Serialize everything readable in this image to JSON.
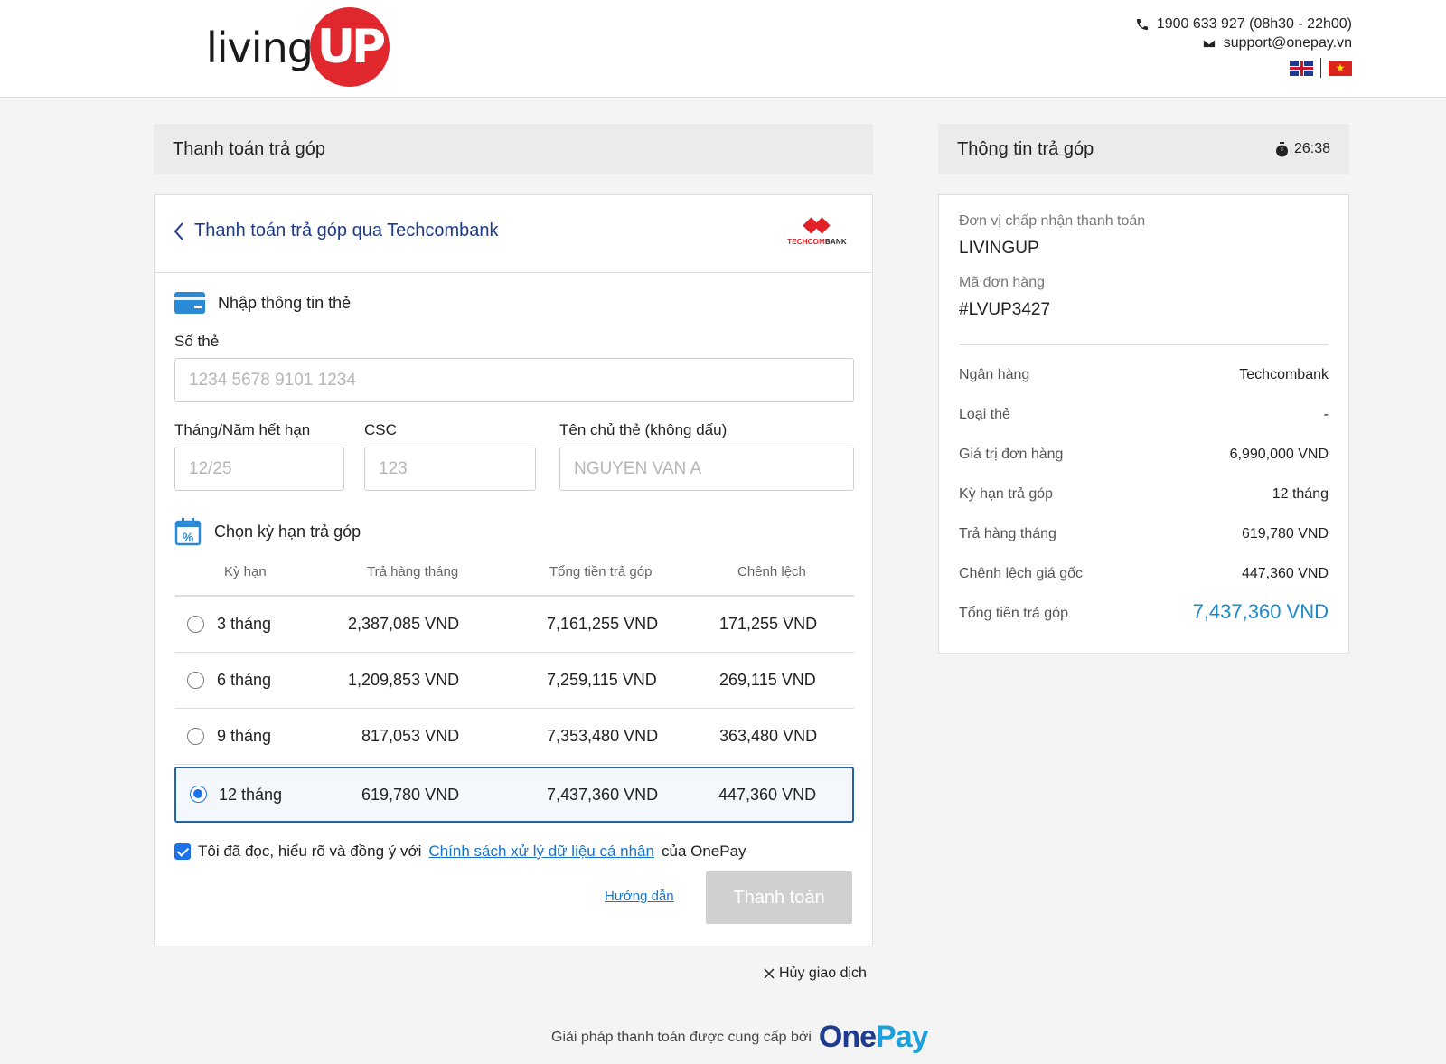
{
  "header": {
    "logo_text": "living",
    "logo_mark": "UP",
    "phone": "1900 633 927 (08h30 - 22h00)",
    "email": "support@onepay.vn",
    "flag_vn_star": "★"
  },
  "left": {
    "title": "Thanh toán trả góp",
    "back_label": "Thanh toán trả góp qua Techcombank",
    "bank_logo_a": "TECHCOM",
    "bank_logo_b": "BANK",
    "card_section": "Nhập thông tin thẻ",
    "card_number_label": "Số thẻ",
    "card_number_placeholder": "1234 5678 9101 1234",
    "expiry_label": "Tháng/Năm hết hạn",
    "expiry_placeholder": "12/25",
    "csc_label": "CSC",
    "csc_placeholder": "123",
    "holder_label": "Tên chủ thẻ (không dấu)",
    "holder_placeholder": "NGUYEN VAN A",
    "term_section": "Chọn kỳ hạn trả góp",
    "table_headers": [
      "Kỳ hạn",
      "Trả hàng tháng",
      "Tổng tiền trả góp",
      "Chênh lệch"
    ],
    "terms": [
      {
        "term": "3 tháng",
        "monthly": "2,387,085 VND",
        "total": "7,161,255 VND",
        "diff": "171,255 VND",
        "selected": false
      },
      {
        "term": "6 tháng",
        "monthly": "1,209,853 VND",
        "total": "7,259,115 VND",
        "diff": "269,115 VND",
        "selected": false
      },
      {
        "term": "9 tháng",
        "monthly": "817,053 VND",
        "total": "7,353,480 VND",
        "diff": "363,480 VND",
        "selected": false
      },
      {
        "term": "12 tháng",
        "monthly": "619,780 VND",
        "total": "7,437,360 VND",
        "diff": "447,360 VND",
        "selected": true
      }
    ],
    "agree_prefix": "Tôi đã đọc, hiểu rõ và đồng ý với",
    "agree_link": "Chính sách xử lý dữ liệu cá nhân",
    "agree_suffix": "của OnePay",
    "agree_checked": true,
    "guide_label": "Hướng dẫn",
    "pay_label": "Thanh toán",
    "cancel_label": "Hủy giao dịch"
  },
  "footer": {
    "text": "Giải pháp thanh toán được cung cấp bởi",
    "brand_one": "One",
    "brand_pay": "Pay"
  },
  "right": {
    "title": "Thông tin trả góp",
    "timer": "26:38",
    "merchant_label": "Đơn vị chấp nhận thanh toán",
    "merchant_value": "LIVINGUP",
    "order_label": "Mã đơn hàng",
    "order_value": "#LVUP3427",
    "rows": [
      {
        "key": "Ngân hàng",
        "value": "Techcombank"
      },
      {
        "key": "Loại thẻ",
        "value": "-"
      },
      {
        "key": "Giá trị đơn hàng",
        "value": "6,990,000 VND"
      },
      {
        "key": "Kỳ hạn trả góp",
        "value": "12 tháng"
      },
      {
        "key": "Trả hàng tháng",
        "value": "619,780 VND"
      },
      {
        "key": "Chênh lệch giá gốc",
        "value": "447,360 VND"
      },
      {
        "key": "Tổng tiền trả góp",
        "value": "7,437,360 VND"
      }
    ]
  },
  "colors": {
    "brand_red": "#e0282e",
    "link_blue": "#1a73c8",
    "total_blue": "#1a88c9",
    "selected_border": "#1f64a8"
  }
}
